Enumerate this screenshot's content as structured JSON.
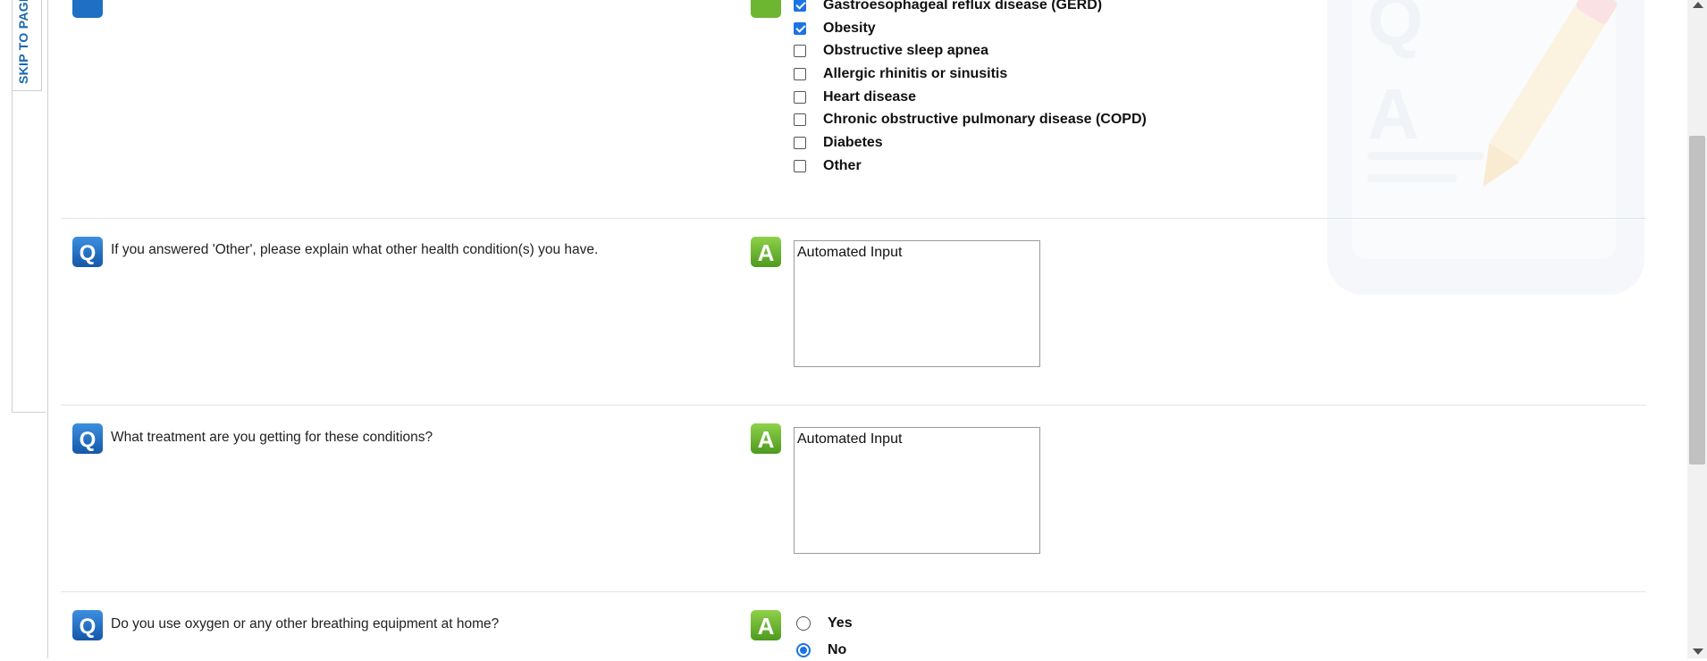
{
  "sidebar": {
    "skip_label": "SKIP TO PAGE"
  },
  "icons": {
    "question_letter": "Q",
    "answer_letter": "A"
  },
  "conditions": {
    "options": [
      {
        "label": "Gastroesophageal reflux disease (GERD)",
        "checked": true
      },
      {
        "label": "Obesity",
        "checked": true
      },
      {
        "label": "Obstructive sleep apnea",
        "checked": false
      },
      {
        "label": "Allergic rhinitis or sinusitis",
        "checked": false
      },
      {
        "label": "Heart disease",
        "checked": false
      },
      {
        "label": "Chronic obstructive pulmonary disease (COPD)",
        "checked": false
      },
      {
        "label": "Diabetes",
        "checked": false
      },
      {
        "label": "Other",
        "checked": false
      }
    ]
  },
  "questions": [
    {
      "text": "If you answered 'Other', please explain what other health condition(s) you have.",
      "answer": "Automated Input"
    },
    {
      "text": "What treatment are you getting for these conditions?",
      "answer": "Automated Input"
    },
    {
      "text": "Do you use oxygen or any other breathing equipment at home?",
      "options": [
        {
          "label": "Yes",
          "selected": false
        },
        {
          "label": "No",
          "selected": true
        }
      ]
    }
  ],
  "colors": {
    "question_icon": "#1f6fc4",
    "answer_icon": "#6cb632",
    "accent": "#1a73e8",
    "skip_text": "#1a66b0"
  }
}
